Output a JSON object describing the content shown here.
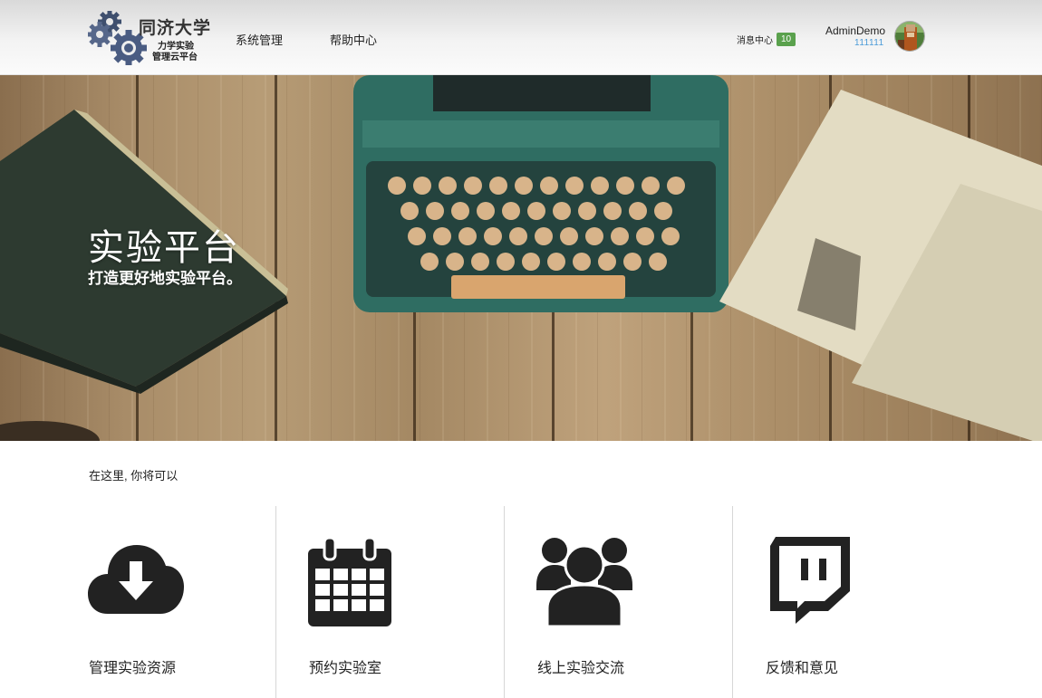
{
  "header": {
    "logo": {
      "title": "同济大学",
      "subtitle_line1": "力学实验",
      "subtitle_line2": "管理云平台",
      "icon": "gears-icon"
    },
    "nav": [
      {
        "label": "系统管理"
      },
      {
        "label": "帮助中心"
      }
    ],
    "messages": {
      "label": "消息中心",
      "count": "10",
      "badge_color": "#5aa14d"
    },
    "user": {
      "name": "AdminDemo",
      "id": "111111",
      "id_color": "#4a9ad8"
    }
  },
  "hero": {
    "title": "实验平台",
    "subtitle": "打造更好地实验平台。"
  },
  "features": {
    "intro": "在这里, 你将可以",
    "items": [
      {
        "label": "管理实验资源",
        "icon": "cloud-download-icon"
      },
      {
        "label": "预约实验室",
        "icon": "calendar-icon"
      },
      {
        "label": "线上实验交流",
        "icon": "users-group-icon"
      },
      {
        "label": "反馈和意见",
        "icon": "feedback-chat-icon"
      }
    ]
  }
}
